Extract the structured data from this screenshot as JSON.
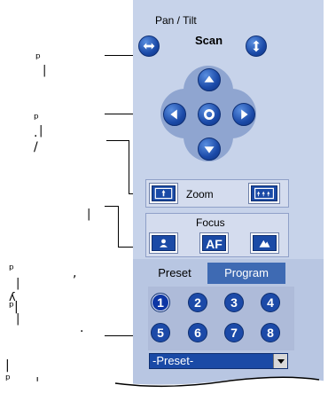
{
  "panel": {
    "pan_tilt_title": "Pan / Tilt",
    "scan_label": "Scan",
    "zoom_label": "Zoom",
    "focus_label": "Focus",
    "af_label": "AF",
    "preset_tab": "Preset",
    "program_tab": "Program",
    "preset_numbers": [
      "1",
      "2",
      "3",
      "4",
      "5",
      "6",
      "7",
      "8"
    ],
    "preset_select_value": "-Preset-"
  },
  "callouts": {
    "c1": "ᵖ ,",
    "c2": "ᵖ . /",
    "c3": "|",
    "c4": "ᵖ ,",
    "c5": "ᵖ .",
    "c6": "|ᵖ `",
    "marks": [
      "ᵖ",
      "ᵖ",
      "ᵖ",
      "ᵖ",
      "ᵖ"
    ]
  },
  "colors": {
    "accent_blue": "#1a4aa6",
    "panel_bg": "#c7d3ea",
    "program_tab_bg": "#3e6ab3"
  }
}
